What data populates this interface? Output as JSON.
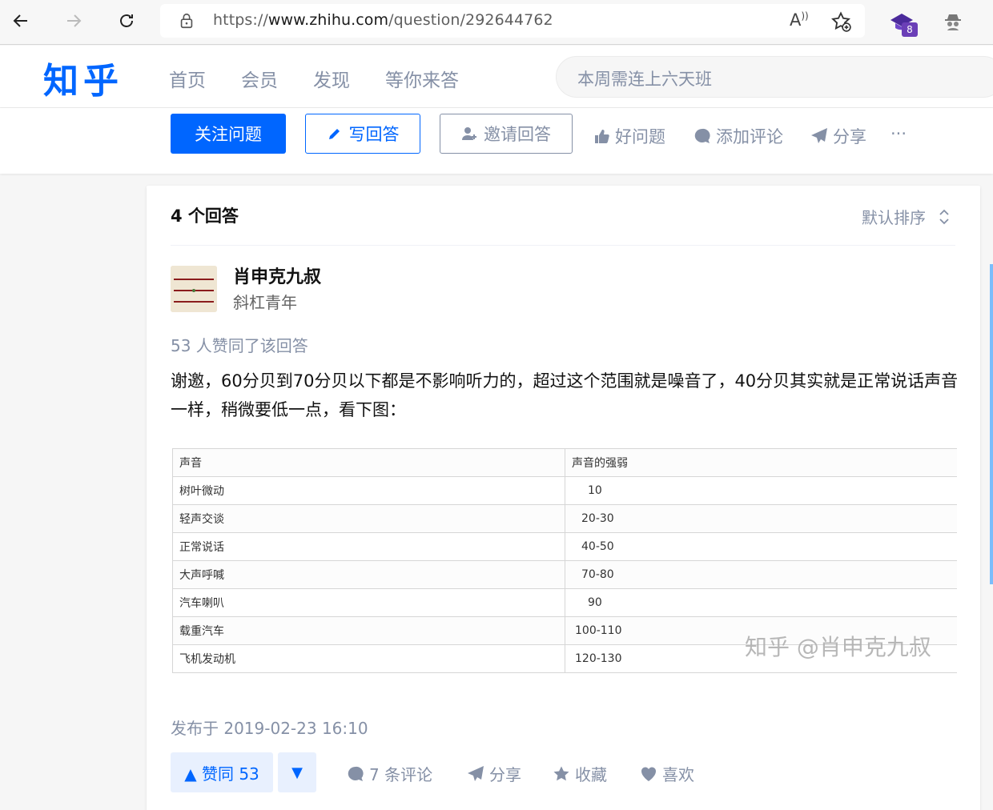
{
  "browser": {
    "url_prefix": "https://",
    "url_host": "www.zhihu.com",
    "url_path": "/question/292644762",
    "read_aloud": "A",
    "extension_badge": "8"
  },
  "header": {
    "logo": "知乎",
    "nav": [
      "首页",
      "会员",
      "发现",
      "等你来答"
    ],
    "search_placeholder": "本周需连上六天班"
  },
  "question_bar": {
    "follow": "关注问题",
    "write": "写回答",
    "invite": "邀请回答",
    "good": "好问题",
    "comment": "添加评论",
    "share": "分享",
    "more": "···"
  },
  "answers": {
    "count_label": "4 个回答",
    "sort_label": "默认排序",
    "author": {
      "name": "肖申克九叔",
      "headline": "斜杠青年"
    },
    "votes_text": "53 人赞同了该回答",
    "content": "谢邀，60分贝到70分贝以下都是不影响听力的，超过这个范围就是噪音了，40分贝其实就是正常说话声音一样，稍微要低一点，看下图：",
    "table": {
      "header": [
        "声音",
        "声音的强弱"
      ],
      "rows": [
        [
          "树叶微动",
          "10"
        ],
        [
          "轻声交谈",
          "20-30"
        ],
        [
          "正常说话",
          "40-50"
        ],
        [
          "大声呼喊",
          "70-80"
        ],
        [
          "汽车喇叭",
          "90"
        ],
        [
          "载重汽车",
          "100-110"
        ],
        [
          "飞机发动机",
          "120-130"
        ]
      ]
    },
    "watermark": "知乎 @肖申克九叔",
    "posted": "发布于 2019-02-23 16:10",
    "vote_up": "▲ 赞同 53",
    "vote_down": "▼",
    "comments": "7 条评论",
    "share": "分享",
    "collect": "收藏",
    "like": "喜欢"
  },
  "colors": {
    "brand": "#0066ff",
    "muted": "#8590a6"
  }
}
